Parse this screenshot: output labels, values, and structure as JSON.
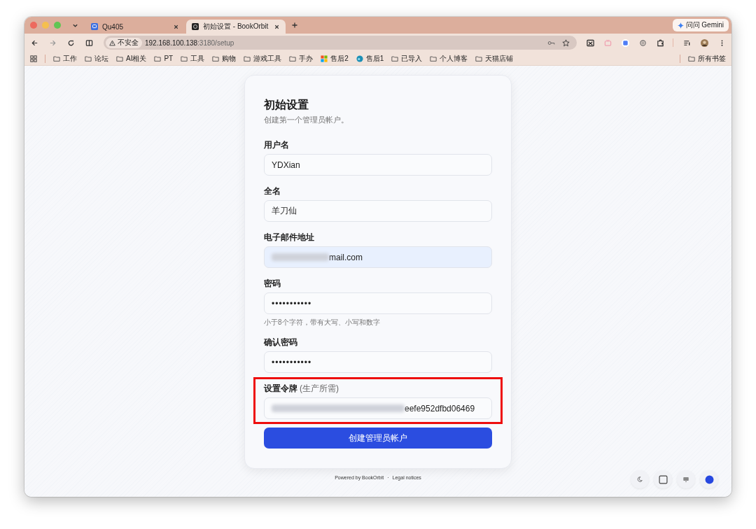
{
  "browser": {
    "tabs": [
      {
        "title": "Qu405",
        "selected": false
      },
      {
        "title": "初始设置 - BookOrbit",
        "selected": true
      }
    ],
    "address": {
      "security": "不安全",
      "host": "192.168.100.138",
      "path": ":3180/setup"
    },
    "gemini_button": "问问 Gemini",
    "bookmarks": [
      {
        "label": "工作",
        "kind": "folder"
      },
      {
        "label": "论坛",
        "kind": "folder"
      },
      {
        "label": "AI相关",
        "kind": "folder"
      },
      {
        "label": "PT",
        "kind": "folder"
      },
      {
        "label": "工具",
        "kind": "folder"
      },
      {
        "label": "购物",
        "kind": "folder"
      },
      {
        "label": "游戏工具",
        "kind": "folder"
      },
      {
        "label": "手办",
        "kind": "folder"
      },
      {
        "label": "售后2",
        "kind": "tiles"
      },
      {
        "label": "售后1",
        "kind": "app"
      },
      {
        "label": "已导入",
        "kind": "folder"
      },
      {
        "label": "个人博客",
        "kind": "folder"
      },
      {
        "label": "天猫店铺",
        "kind": "folder"
      }
    ],
    "all_bookmarks": "所有书签"
  },
  "setup": {
    "title": "初始设置",
    "subtitle": "创建第一个管理员帐户。",
    "fields": [
      {
        "label": "用户名",
        "value": "YDXian",
        "kind": "text"
      },
      {
        "label": "全名",
        "value": "羊刀仙",
        "kind": "text"
      },
      {
        "label": "电子邮件地址",
        "value": "mail.com",
        "kind": "email",
        "redacted": true,
        "autofilled": true
      },
      {
        "label": "密码",
        "value": "•••••••••••",
        "kind": "password",
        "hint": "小于8个字符，带有大写、小写和数字"
      },
      {
        "label": "确认密码",
        "value": "•••••••••••",
        "kind": "password"
      },
      {
        "label": "设置令牌",
        "note": "(生产所需)",
        "value": "eefe952dfbd06469",
        "kind": "text",
        "redacted": true,
        "highlighted": true
      }
    ],
    "submit": "创建管理员帐户"
  },
  "footer": {
    "powered": "Powered by BookOrbit",
    "separator": "·",
    "legal": "Legal notices"
  },
  "corner_buttons": [
    {
      "kind": "moon"
    },
    {
      "kind": "square"
    },
    {
      "kind": "display"
    },
    {
      "kind": "dot"
    }
  ]
}
